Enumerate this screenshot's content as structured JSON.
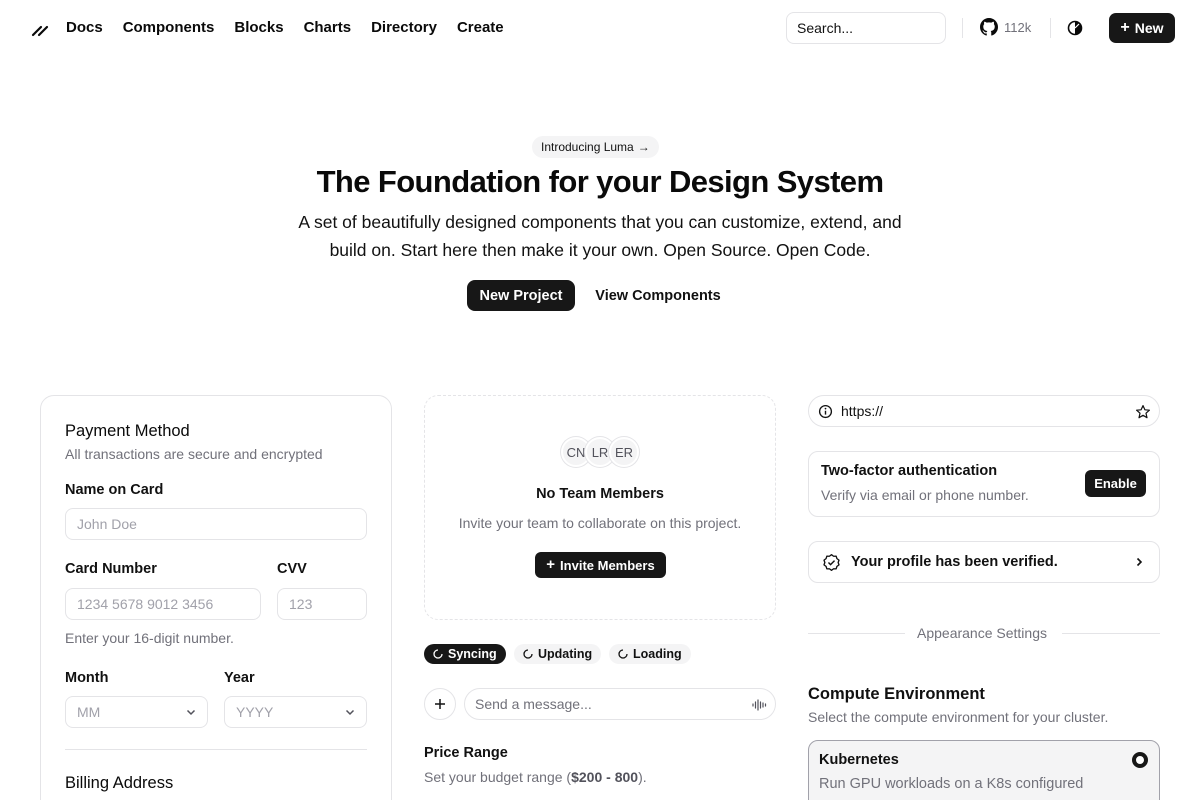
{
  "header": {
    "nav": [
      "Docs",
      "Components",
      "Blocks",
      "Charts",
      "Directory",
      "Create"
    ],
    "search_placeholder": "Search...",
    "github_count": "112k",
    "new_label": "New"
  },
  "hero": {
    "badge": "Introducing Luma",
    "title": "The Foundation for your Design System",
    "subtitle": "A set of beautifully designed components that you can customize, extend, and build on. Start here then make it your own. Open Source. Open Code.",
    "primary_cta": "New Project",
    "secondary_cta": "View Components"
  },
  "payment": {
    "title": "Payment Method",
    "subtitle": "All transactions are secure and encrypted",
    "name_label": "Name on Card",
    "name_placeholder": "John Doe",
    "card_label": "Card Number",
    "card_placeholder": "1234 5678 9012 3456",
    "cvv_label": "CVV",
    "cvv_placeholder": "123",
    "card_hint": "Enter your 16-digit number.",
    "month_label": "Month",
    "month_value": "MM",
    "year_label": "Year",
    "year_value": "YYYY",
    "billing_title": "Billing Address"
  },
  "team": {
    "avatars": [
      "CN",
      "LR",
      "ER"
    ],
    "title": "No Team Members",
    "description": "Invite your team to collaborate on this project.",
    "invite_label": "Invite Members"
  },
  "status_pills": [
    "Syncing",
    "Updating",
    "Loading"
  ],
  "chat": {
    "placeholder": "Send a message..."
  },
  "price": {
    "title": "Price Range",
    "prefix": "Set your budget range (",
    "range": "$200 - 800",
    "suffix": ")."
  },
  "url_input": {
    "value": "https://"
  },
  "two_factor": {
    "title": "Two-factor authentication",
    "description": "Verify via email or phone number.",
    "button": "Enable"
  },
  "verified": {
    "text": "Your profile has been verified."
  },
  "appearance": {
    "separator_label": "Appearance Settings"
  },
  "compute": {
    "title": "Compute Environment",
    "subtitle": "Select the compute environment for your cluster.",
    "option_title": "Kubernetes",
    "option_description": "Run GPU workloads on a K8s configured"
  }
}
